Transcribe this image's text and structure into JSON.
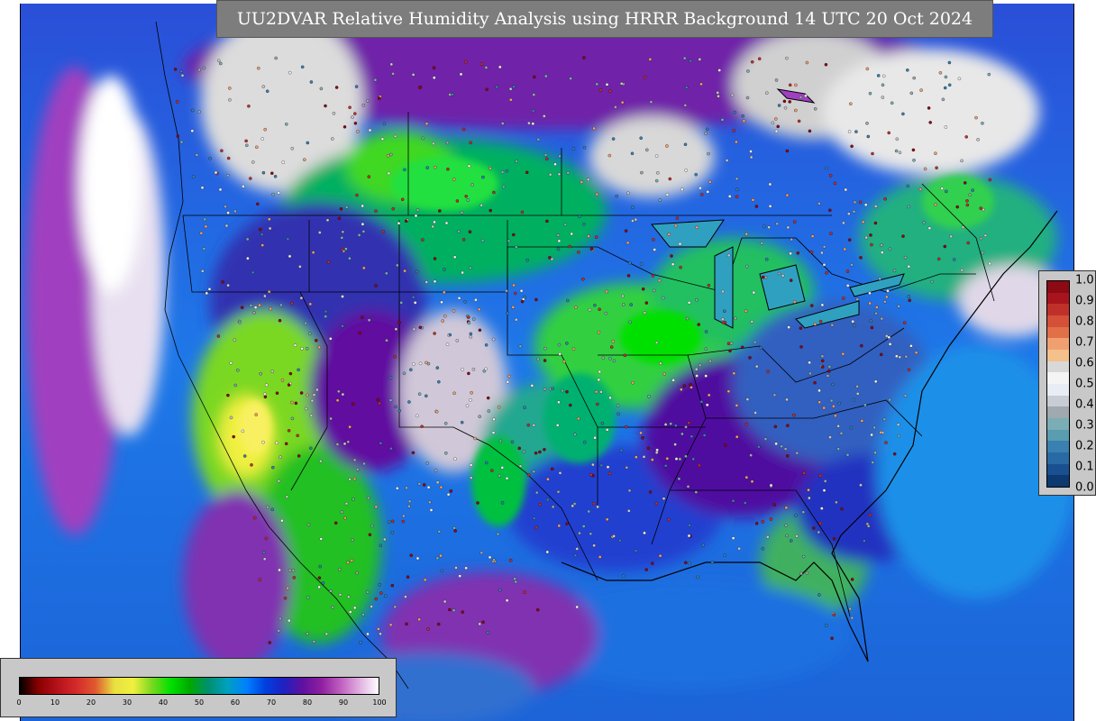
{
  "title": "UU2DVAR Relative Humidity Analysis using HRRR Background 14 UTC 20 Oct 2024",
  "humidity_colorbar": {
    "ticks": [
      "0",
      "10",
      "20",
      "30",
      "40",
      "50",
      "60",
      "70",
      "80",
      "90",
      "100"
    ],
    "colors": [
      "#000000",
      "#8b0000",
      "#b5121b",
      "#d42a2a",
      "#e05a30",
      "#e8e040",
      "#f0f040",
      "#7ad820",
      "#00e000",
      "#00a800",
      "#009070",
      "#00a0c0",
      "#0080ff",
      "#0040e0",
      "#2020c0",
      "#6010a0",
      "#9020a0",
      "#c060c0",
      "#e0b0e0",
      "#ffffff"
    ]
  },
  "obs_legend": {
    "labels": [
      "1.0",
      "0.9",
      "0.8",
      "0.7",
      "0.6",
      "0.5",
      "0.4",
      "0.3",
      "0.2",
      "0.1",
      "0.0"
    ],
    "colors": [
      "#8b0a14",
      "#a8141e",
      "#c0302a",
      "#d45038",
      "#e07048",
      "#f0a070",
      "#f4c08c",
      "#d8d8d8",
      "#f4f4f4",
      "#e8ecf4",
      "#c8ccd4",
      "#a0a8b0",
      "#7aaeb4",
      "#5a9cb0",
      "#3a80b0",
      "#2a6aa4",
      "#1a5090",
      "#0c3a70"
    ]
  }
}
